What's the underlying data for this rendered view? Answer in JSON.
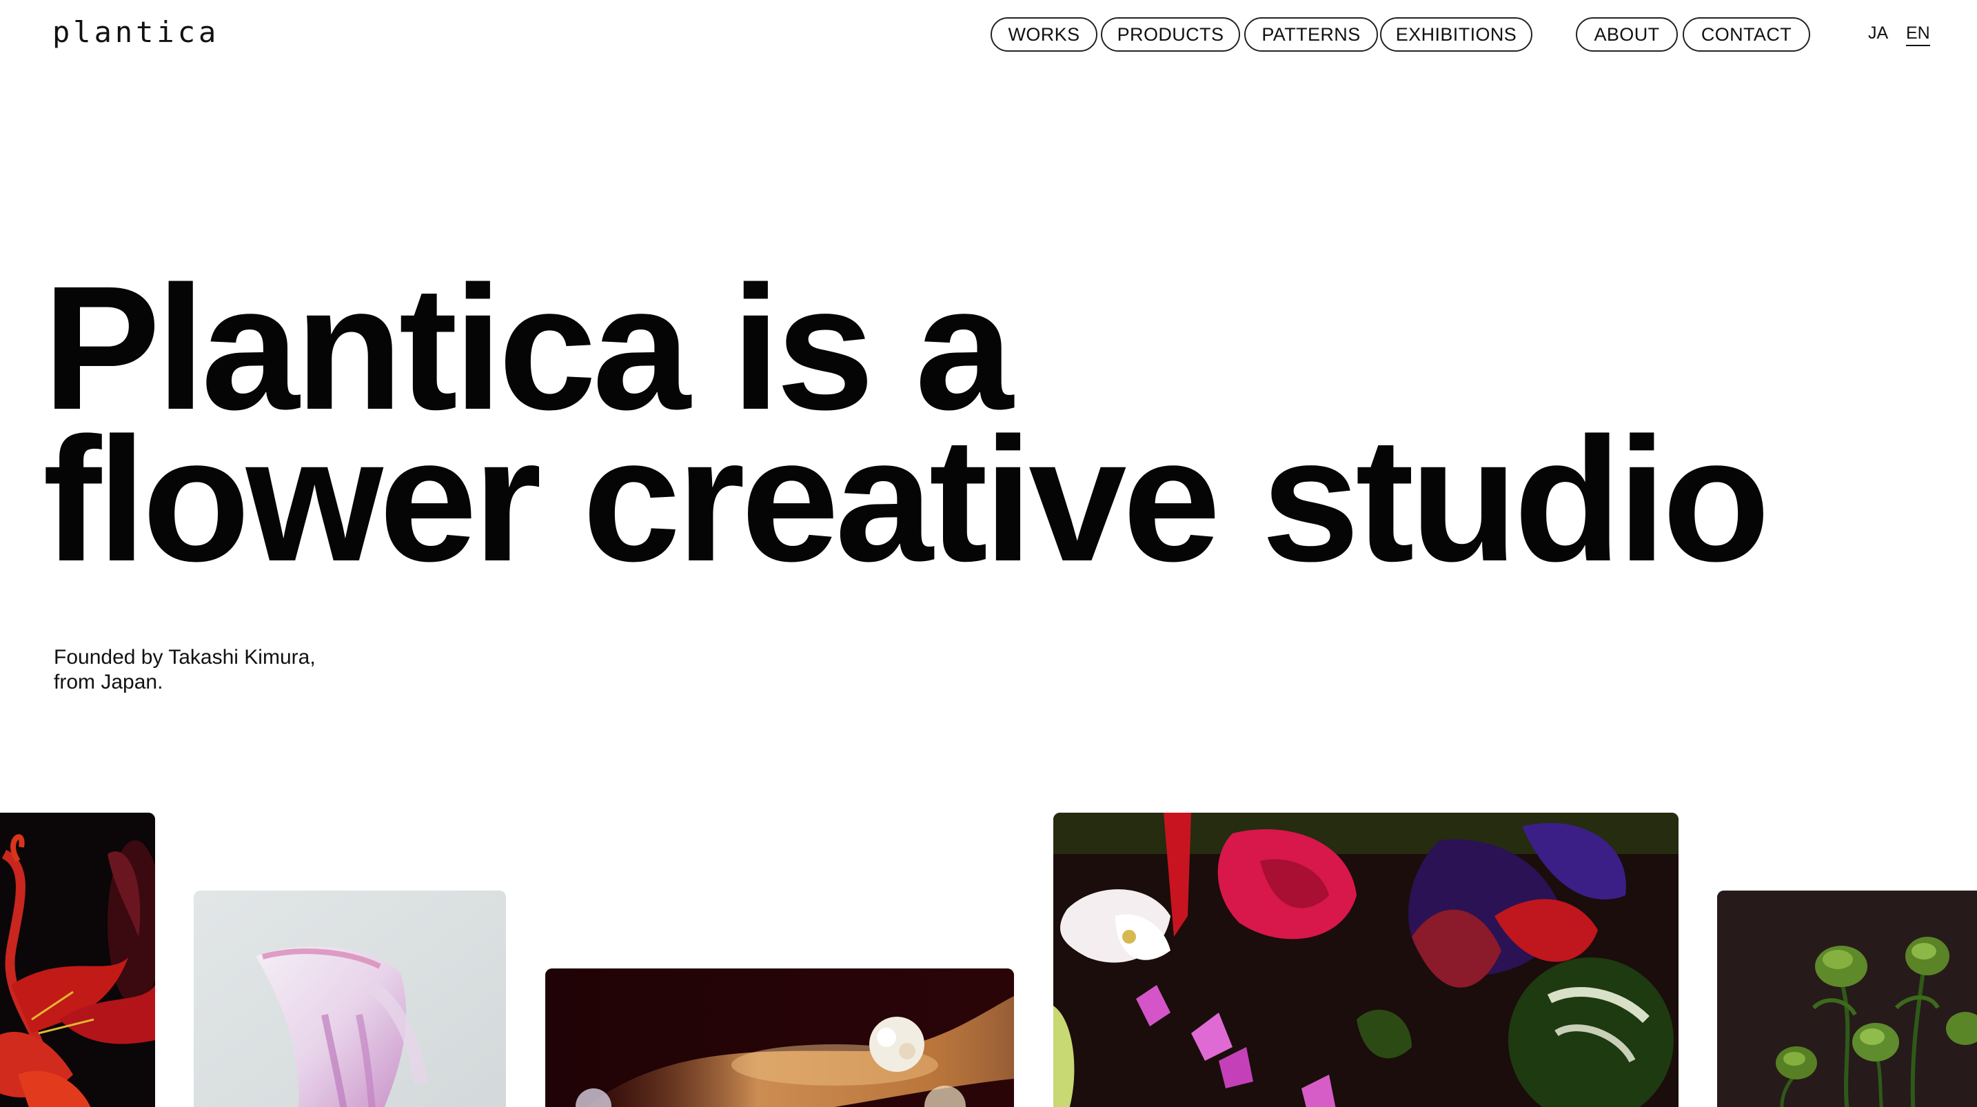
{
  "header": {
    "logo": "plantica",
    "nav": [
      {
        "label": "WORKS"
      },
      {
        "label": "PRODUCTS"
      },
      {
        "label": "PATTERNS"
      },
      {
        "label": "EXHIBITIONS"
      },
      {
        "label": "ABOUT"
      },
      {
        "label": "CONTACT"
      }
    ],
    "languages": [
      {
        "label": "JA",
        "active": false
      },
      {
        "label": "EN",
        "active": true
      }
    ]
  },
  "hero": {
    "title_line1": "Plantica is a",
    "title_line2": "flower creative studio",
    "founder_line1": "Founded by Takashi Kimura,",
    "founder_line2": "from Japan."
  },
  "gallery": [
    {
      "icon": "red-lily-image"
    },
    {
      "icon": "pink-petal-image"
    },
    {
      "icon": "blurred-flowers-image"
    },
    {
      "icon": "mixed-bouquet-image"
    },
    {
      "icon": "green-buds-image"
    }
  ],
  "colors": {
    "background": "#ffffff",
    "text": "#0a0a0a",
    "pill_border": "#222222"
  }
}
